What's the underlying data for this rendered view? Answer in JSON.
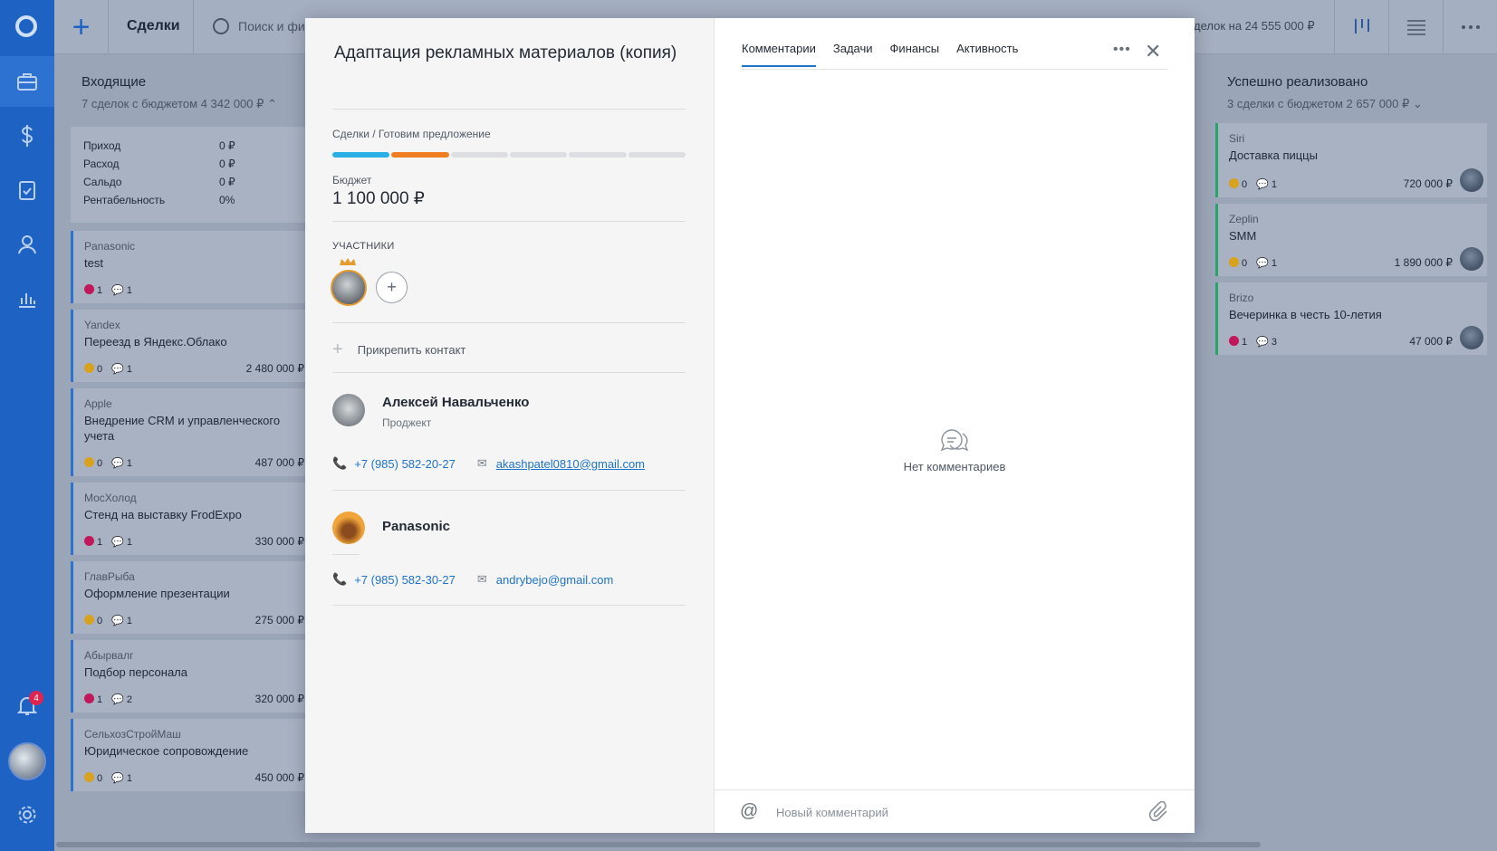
{
  "rail": {
    "notification_count": "4"
  },
  "topbar": {
    "title": "Сделки",
    "search_placeholder": "Поиск и фи",
    "summary": "делок на 24 555 000 ₽"
  },
  "board": {
    "incoming": {
      "title": "Входящие",
      "subtitle": "7 сделок с бюджетом 4 342 000 ₽",
      "finance": [
        {
          "label": "Приход",
          "value": "0 ₽"
        },
        {
          "label": "Расход",
          "value": "0 ₽"
        },
        {
          "label": "Сальдо",
          "value": "0 ₽"
        },
        {
          "label": "Рентабельность",
          "value": "0%"
        }
      ],
      "cards": [
        {
          "company": "Panasonic",
          "name": "test",
          "tasks": "1",
          "comments": "1",
          "amount": "",
          "status": "red"
        },
        {
          "company": "Yandex",
          "name": "Переезд в Яндекс.Облако",
          "tasks": "0",
          "comments": "1",
          "amount": "2 480 000 ₽",
          "status": "orange"
        },
        {
          "company": "Apple",
          "name": "Внедрение CRM и управленческого учета",
          "tasks": "0",
          "comments": "1",
          "amount": "487 000 ₽",
          "status": "orange"
        },
        {
          "company": "МосХолод",
          "name": "Стенд на выставку FrodExpo",
          "tasks": "1",
          "comments": "1",
          "amount": "330 000 ₽",
          "status": "red"
        },
        {
          "company": "ГлавРыба",
          "name": "Оформление презентации",
          "tasks": "0",
          "comments": "1",
          "amount": "275 000 ₽",
          "status": "orange"
        },
        {
          "company": "Абырвалг",
          "name": "Подбор персонала",
          "tasks": "1",
          "comments": "2",
          "amount": "320 000 ₽",
          "status": "red"
        },
        {
          "company": "СельхозСтройМаш",
          "name": "Юридическое сопровождение",
          "tasks": "0",
          "comments": "1",
          "amount": "450 000 ₽",
          "status": "orange"
        }
      ]
    },
    "done": {
      "title": "Успешно реализовано",
      "subtitle": "3 сделки с бюджетом 2 657 000 ₽",
      "cards": [
        {
          "company": "Siri",
          "name": "Доставка пиццы",
          "tasks": "0",
          "comments": "1",
          "amount": "720 000 ₽",
          "status": "orange"
        },
        {
          "company": "Zeplin",
          "name": "SMM",
          "tasks": "0",
          "comments": "1",
          "amount": "1 890 000 ₽",
          "status": "orange"
        },
        {
          "company": "Brizo",
          "name": "Вечеринка в честь 10-летия",
          "tasks": "1",
          "comments": "3",
          "amount": "47 000 ₽",
          "status": "red"
        }
      ]
    }
  },
  "deal": {
    "title": "Адаптация рекламных материалов (копия)",
    "breadcrumb": "Сделки / Готовим предложение",
    "stages": [
      "#2bb0e6",
      "#f07f24",
      "#dcdee2",
      "#dcdee2",
      "#dcdee2",
      "#dcdee2"
    ],
    "budget_label": "Бюджет",
    "budget_value": "1 100 000 ₽",
    "participants_label": "УЧАСТНИКИ",
    "add_participant": "+",
    "attach_contact": "Прикрепить контакт",
    "contacts": [
      {
        "name": "Алексей Навальченко",
        "subtitle": "Проджект",
        "phone": "+7 (985) 582-20-27",
        "email": "akashpatel0810@gmail.com"
      },
      {
        "name": "Panasonic",
        "subtitle": "",
        "phone": "+7 (985) 582-30-27",
        "email": "andrybejo@gmail.com"
      }
    ]
  },
  "right": {
    "tabs": [
      "Комментарии",
      "Задачи",
      "Финансы",
      "Активность"
    ],
    "empty_text": "Нет комментариев",
    "composer_placeholder": "Новый комментарий"
  },
  "colors": {
    "accent": "#1f73c8",
    "rail": "#1e63c4",
    "danger": "#c2185b",
    "warning": "#d8a21f"
  }
}
